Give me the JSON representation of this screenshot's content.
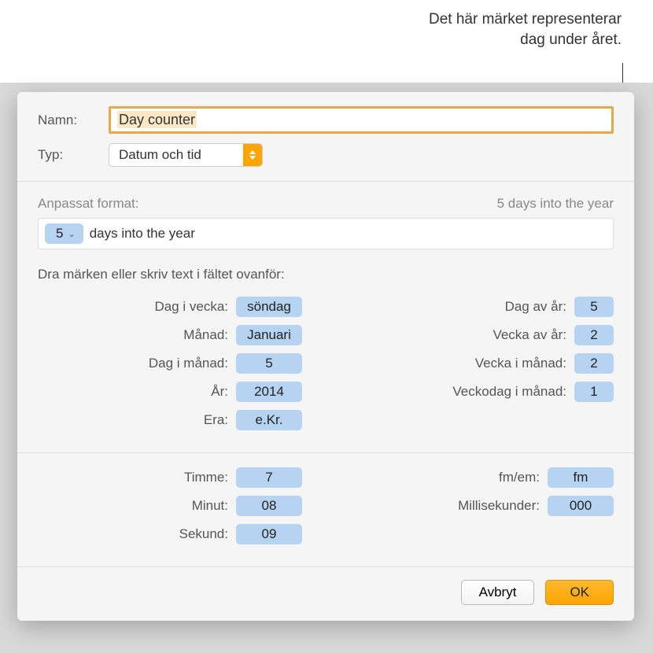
{
  "annotation": {
    "line1": "Det här märket representerar",
    "line2": "dag under året."
  },
  "labels": {
    "name": "Namn:",
    "type": "Typ:",
    "custom_format": "Anpassat format:",
    "drag_instruction": "Dra märken eller skriv text i fältet ovanför:"
  },
  "name_value": "Day counter",
  "type_value": "Datum och tid",
  "preview": "5 days into the year",
  "format_field": {
    "token": "5",
    "text": "days into the year"
  },
  "tokens_left": [
    {
      "label": "Dag i vecka:",
      "value": "söndag"
    },
    {
      "label": "Månad:",
      "value": "Januari"
    },
    {
      "label": "Dag i månad:",
      "value": "5"
    },
    {
      "label": "År:",
      "value": "2014"
    },
    {
      "label": "Era:",
      "value": "e.Kr."
    }
  ],
  "tokens_right": [
    {
      "label": "Dag av år:",
      "value": "5"
    },
    {
      "label": "Vecka av år:",
      "value": "2"
    },
    {
      "label": "Vecka i månad:",
      "value": "2"
    },
    {
      "label": "Veckodag i månad:",
      "value": "1"
    }
  ],
  "time_left": [
    {
      "label": "Timme:",
      "value": "7"
    },
    {
      "label": "Minut:",
      "value": "08"
    },
    {
      "label": "Sekund:",
      "value": "09"
    }
  ],
  "time_right": [
    {
      "label": "fm/em:",
      "value": "fm"
    },
    {
      "label": "Millisekunder:",
      "value": "000"
    }
  ],
  "buttons": {
    "cancel": "Avbryt",
    "ok": "OK"
  }
}
